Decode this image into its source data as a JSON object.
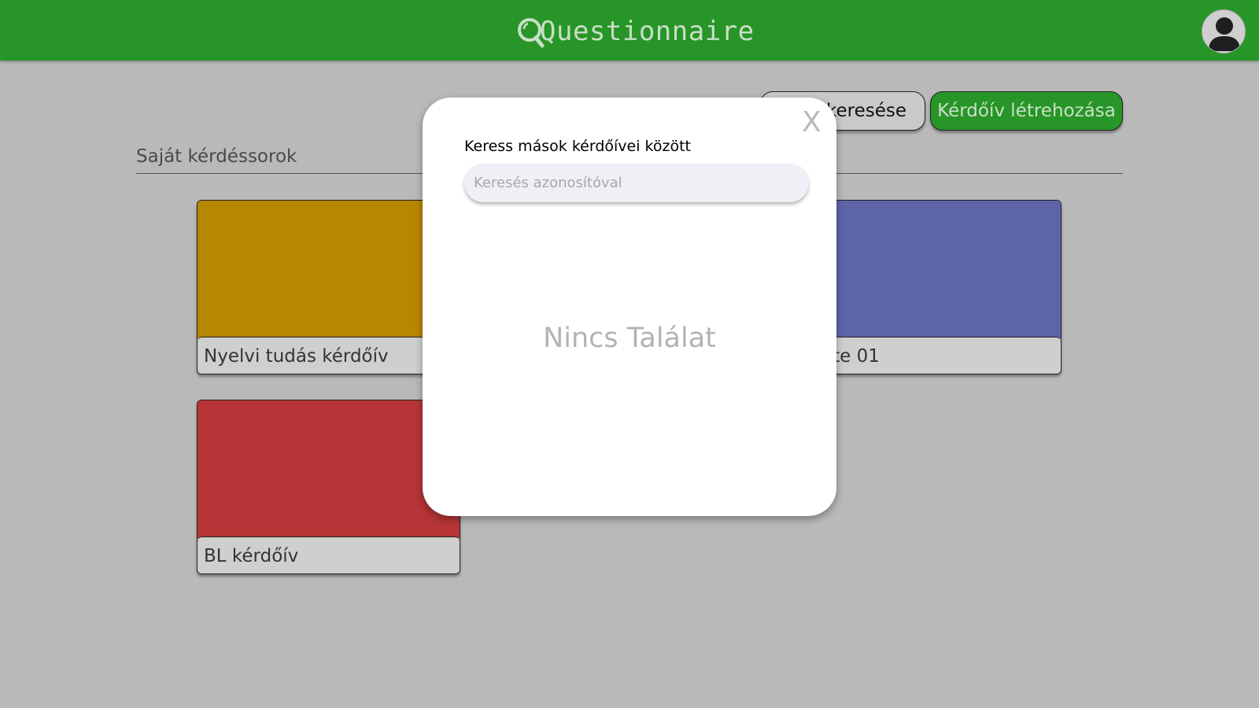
{
  "app": {
    "title": "Questionnaire"
  },
  "header": {
    "logo_icon": "magnifier-q-icon",
    "avatar_icon": "user-avatar-icon"
  },
  "toolbar": {
    "search_label": "keresése",
    "create_label": "Kérdőív létrehozása"
  },
  "section": {
    "title": "Saját kérdéssorok"
  },
  "cards": [
    {
      "label": "Nyelvi tudás kérdőív",
      "color": "#b88600"
    },
    {
      "label": "plate 01",
      "color": "#5e64aa"
    },
    {
      "label": "BL kérdőív",
      "color": "#b73536"
    }
  ],
  "modal": {
    "close_label": "X",
    "heading": "Keress mások kérdőívei között",
    "search_value": "",
    "search_placeholder": "Keresés azonosítóval",
    "empty_text": "Nincs Találat"
  },
  "colors": {
    "header": "#279527",
    "background": "#b9b9b9",
    "accent_text": "#c9dfc6"
  }
}
